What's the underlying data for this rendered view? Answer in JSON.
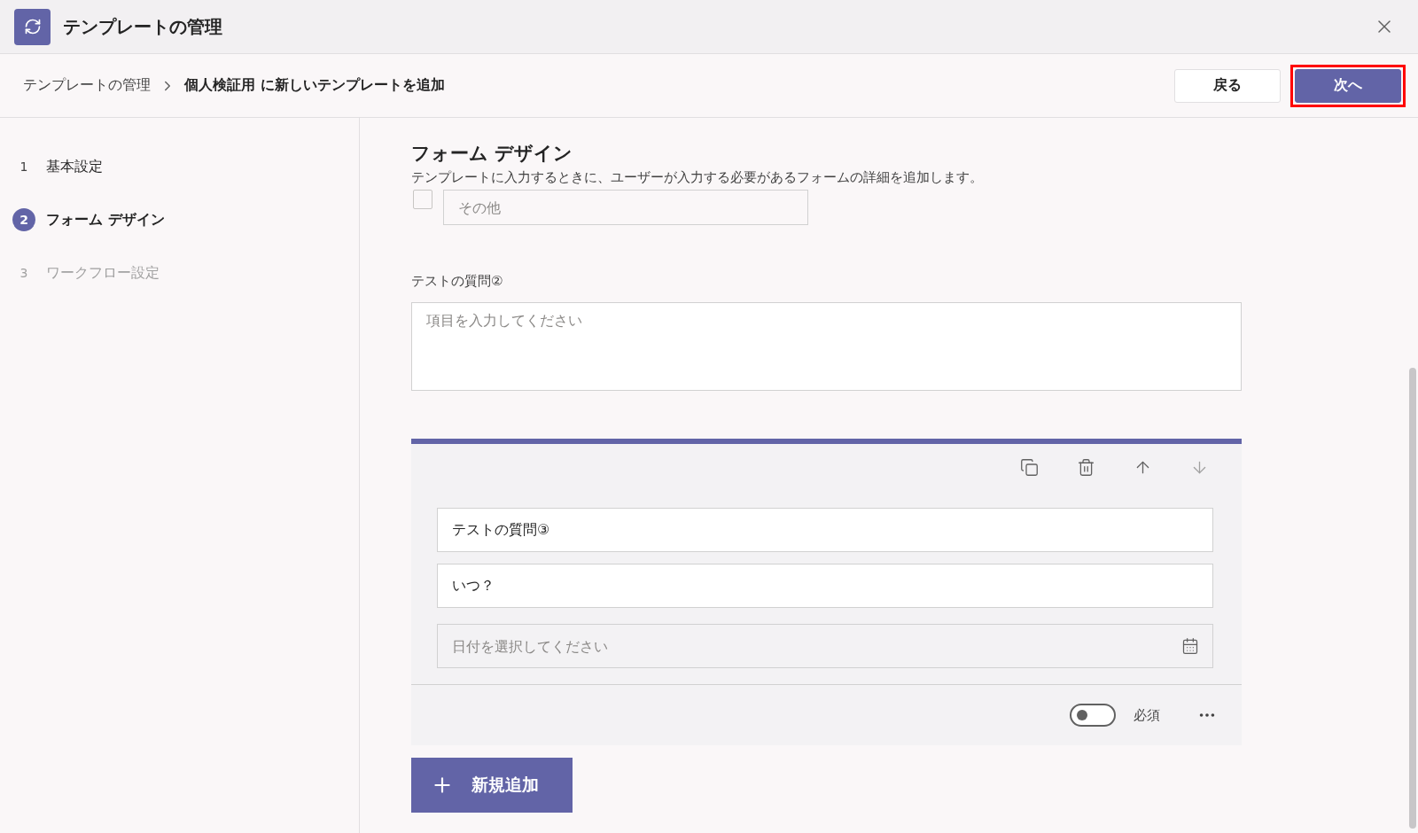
{
  "window": {
    "title": "テンプレートの管理"
  },
  "breadcrumb": [
    {
      "label": "テンプレートの管理",
      "current": false
    },
    {
      "label": "個人検証用 に新しいテンプレートを追加",
      "current": true
    }
  ],
  "actions": [
    {
      "label": "戻る",
      "kind": "secondary",
      "highlighted": false
    },
    {
      "label": "次へ",
      "kind": "primary",
      "highlighted": true
    }
  ],
  "steps": [
    {
      "number": "1",
      "label": "基本設定",
      "selected": false,
      "disabled": false
    },
    {
      "number": "2",
      "label": "フォーム デザイン",
      "selected": true,
      "disabled": false
    },
    {
      "number": "3",
      "label": "ワークフロー設定",
      "selected": false,
      "disabled": true
    }
  ],
  "section": {
    "title": "フォーム デザイン",
    "description": "テンプレートに入力するときに、ユーザーが入力する必要があるフォームの詳細を追加します。"
  },
  "option": {
    "checked": false,
    "placeholder": "その他"
  },
  "question_2": {
    "label": "テストの質問②",
    "placeholder": "項目を入力してください"
  },
  "question_3": {
    "tools": [
      {
        "kind": "copy",
        "disabled": false
      },
      {
        "kind": "delete",
        "disabled": false
      },
      {
        "kind": "up",
        "disabled": false
      },
      {
        "kind": "down",
        "disabled": true
      }
    ],
    "title": "テストの質問③",
    "subtitle": "いつ？",
    "date_placeholder": "日付を選択してください",
    "required": {
      "label": "必須",
      "on": false
    }
  },
  "add_button": {
    "label": "新規追加"
  }
}
